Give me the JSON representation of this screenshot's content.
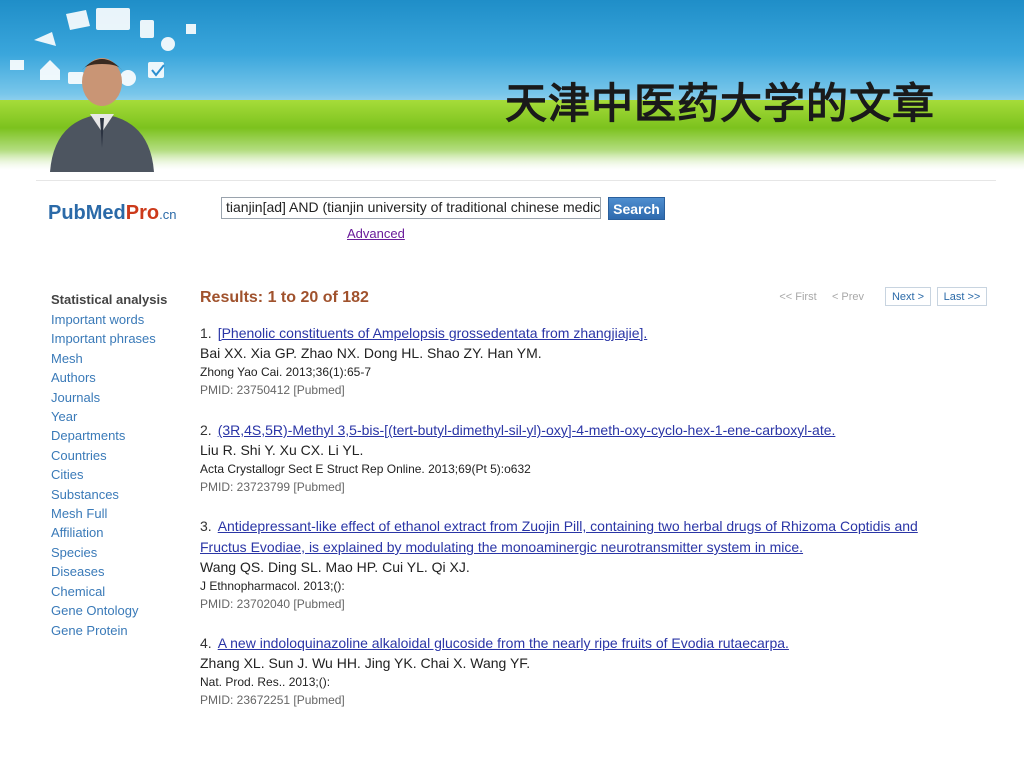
{
  "banner": {
    "title": "天津中医药大学的文章"
  },
  "logo": {
    "text_main": "PubMed",
    "text_pro": "Pro",
    "text_cn": ".cn"
  },
  "search": {
    "value": "tianjin[ad] AND (tianjin university of traditional chinese medicine)",
    "button_label": "Search",
    "advanced_label": "Advanced"
  },
  "sidebar": {
    "heading": "Statistical analysis",
    "items": [
      "Important words",
      "Important phrases",
      "Mesh",
      "Authors",
      "Journals",
      "Year",
      "Departments",
      "Countries",
      "Cities",
      "Substances",
      "Mesh Full",
      "Affiliation",
      "Species",
      "Diseases",
      "Chemical",
      "Gene Ontology",
      "Gene Protein"
    ]
  },
  "results": {
    "count_label": "Results: 1 to 20 of 182",
    "pager": {
      "first": "<< First",
      "prev": "< Prev",
      "next": "Next >",
      "last": "Last >>"
    },
    "items": [
      {
        "num": "1.",
        "title": "[Phenolic constituents of Ampelopsis grossedentata from zhangjiajie].",
        "authors": "Bai XX. Xia GP. Zhao NX. Dong HL. Shao ZY. Han YM.",
        "journal": "Zhong Yao Cai. 2013;36(1):65-7",
        "pmid": "PMID: 23750412 [Pubmed]"
      },
      {
        "num": "2.",
        "title": "(3R,4S,5R)-Methyl 3,5-bis-[(tert-butyl-dimethyl-sil-yl)-oxy]-4-meth-oxy-cyclo-hex-1-ene-carboxyl-ate.",
        "authors": "Liu R. Shi Y. Xu CX. Li YL.",
        "journal": "Acta Crystallogr Sect E Struct Rep Online. 2013;69(Pt 5):o632",
        "pmid": "PMID: 23723799 [Pubmed]"
      },
      {
        "num": "3.",
        "title": "Antidepressant-like effect of ethanol extract from Zuojin Pill, containing two herbal drugs of Rhizoma Coptidis and Fructus Evodiae, is explained by modulating the monoaminergic neurotransmitter system in mice.",
        "authors": "Wang QS. Ding SL. Mao HP. Cui YL. Qi XJ.",
        "journal": "J Ethnopharmacol. 2013;():",
        "pmid": "PMID: 23702040 [Pubmed]"
      },
      {
        "num": "4.",
        "title": "A new indoloquinazoline alkaloidal glucoside from the nearly ripe fruits of Evodia rutaecarpa.",
        "authors": "Zhang XL. Sun J. Wu HH. Jing YK. Chai X. Wang YF.",
        "journal": "Nat. Prod. Res.. 2013;():",
        "pmid": "PMID: 23672251 [Pubmed]"
      }
    ]
  }
}
